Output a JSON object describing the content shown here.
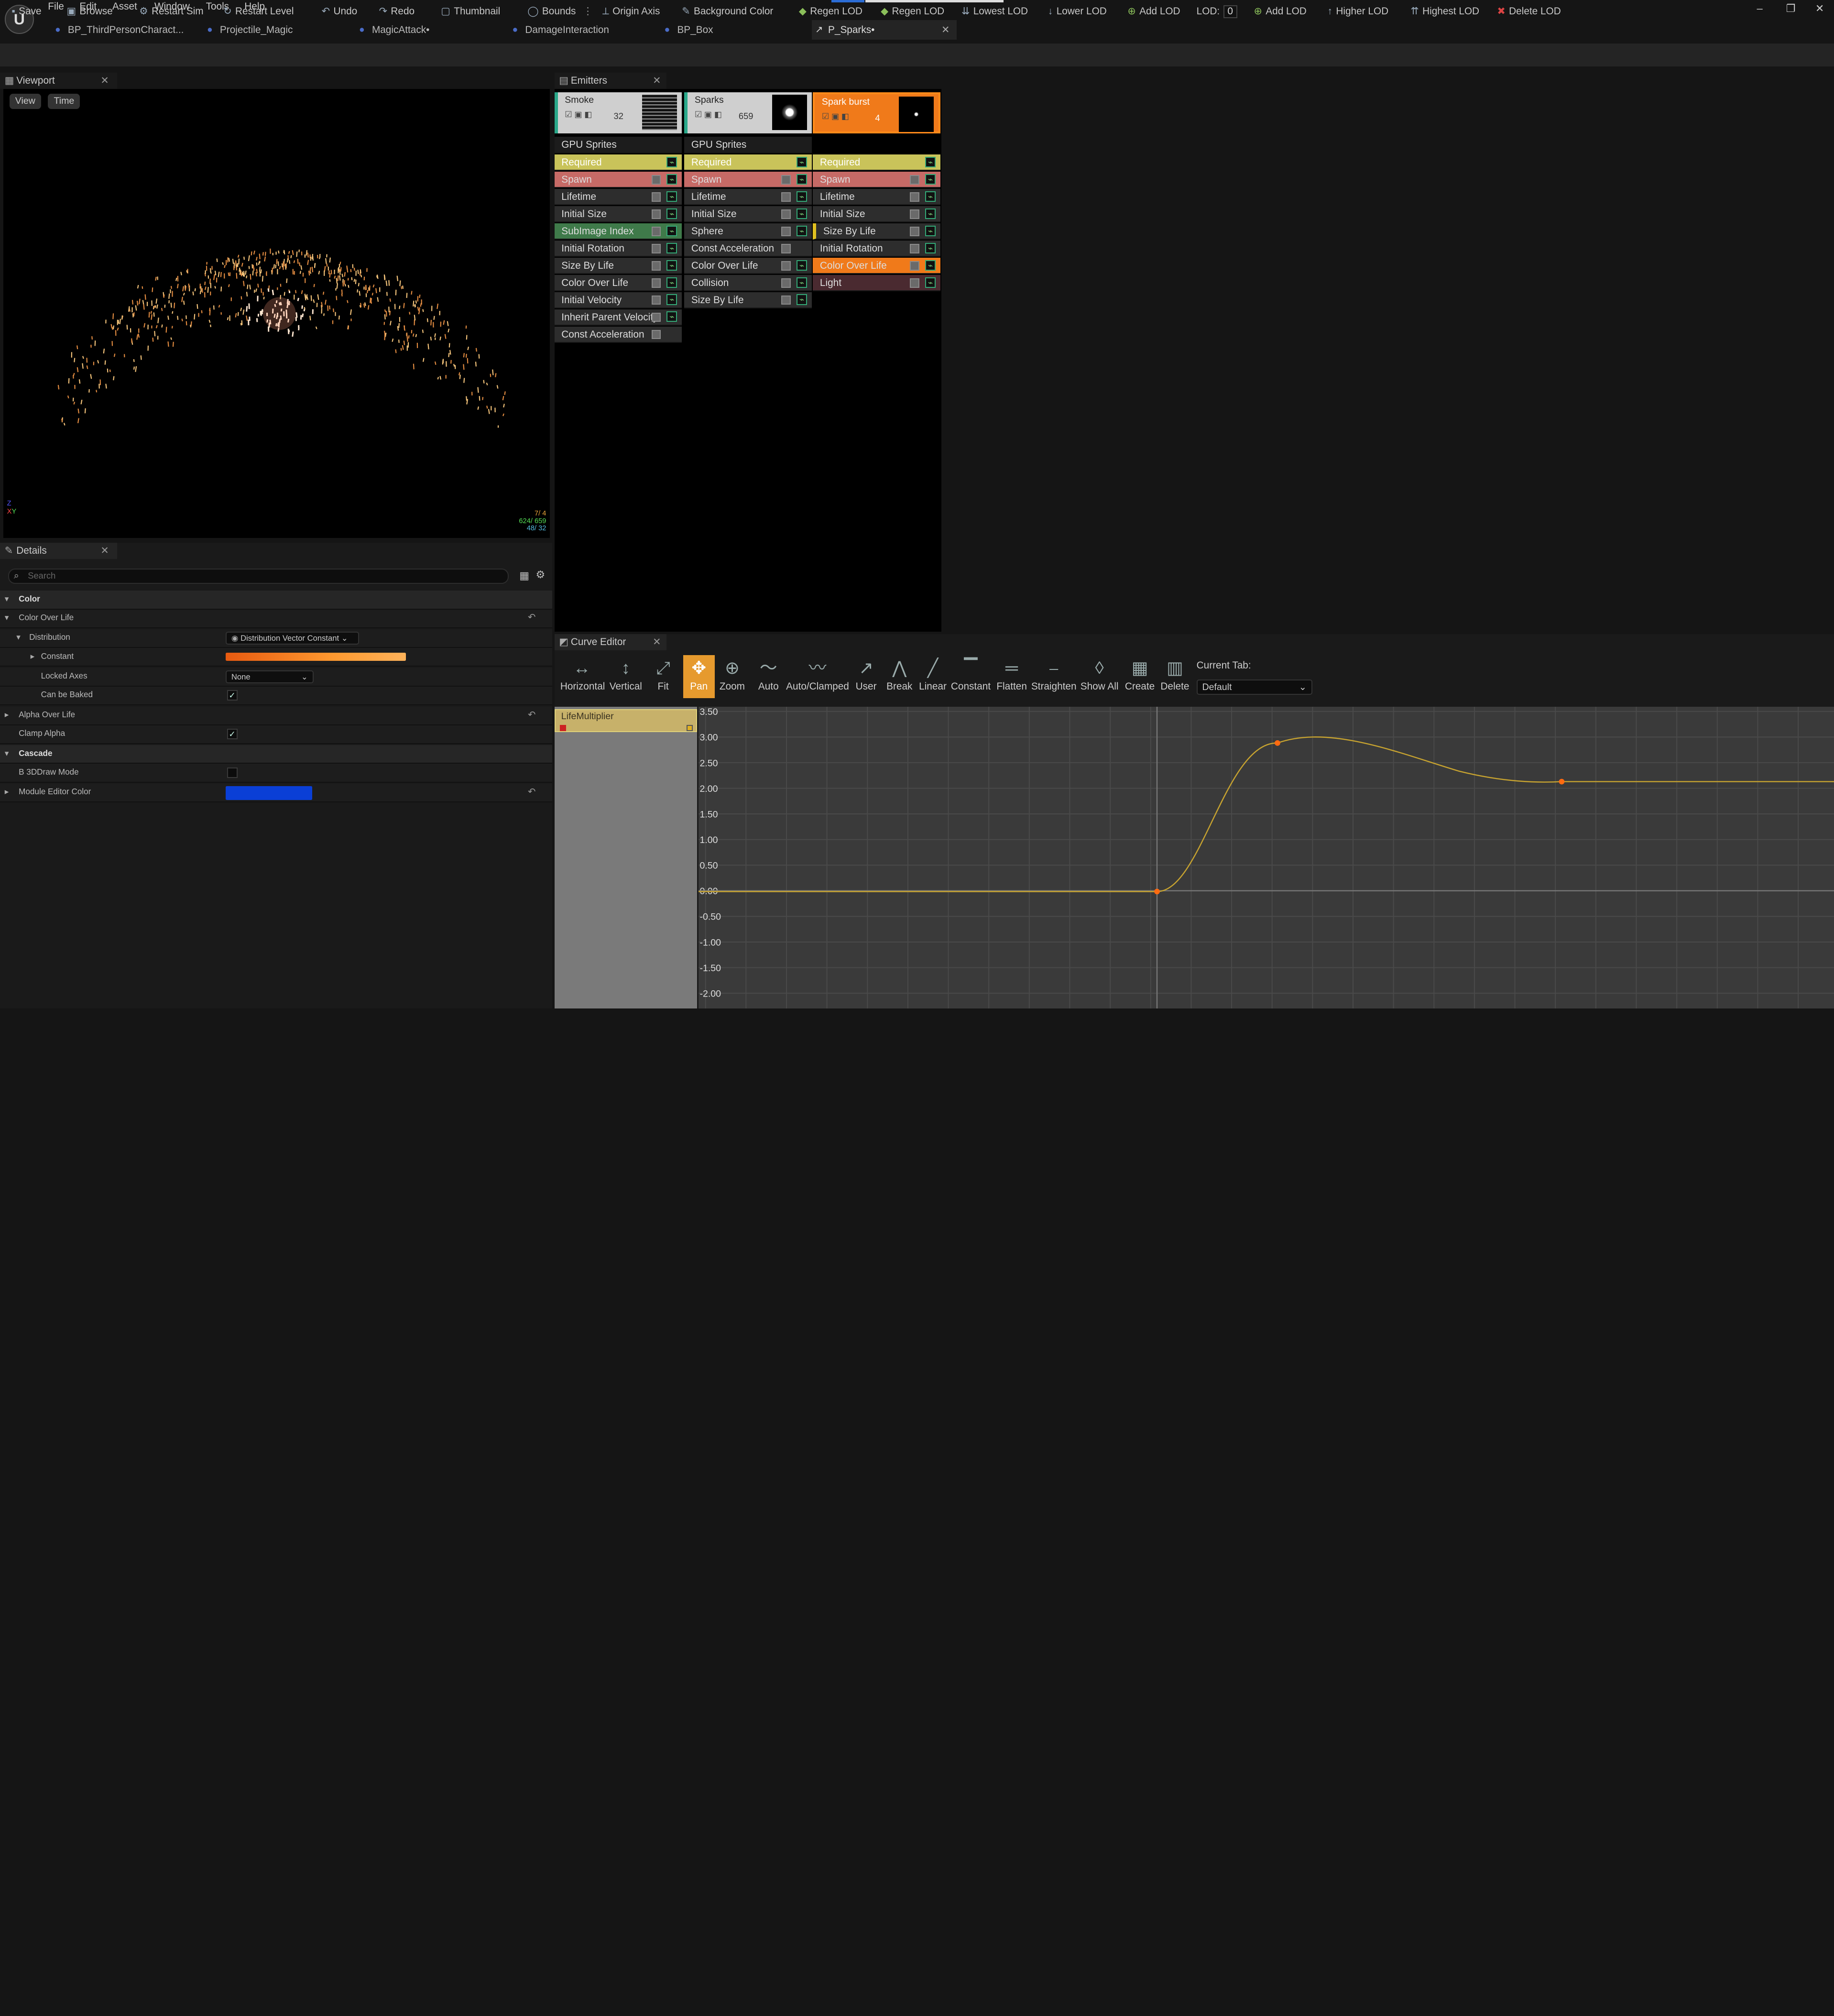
{
  "app": {
    "logo": "U"
  },
  "menu": [
    "File",
    "Edit",
    "Asset",
    "Window",
    "Tools",
    "Help"
  ],
  "window_controls": [
    "minimize-icon",
    "restore-icon",
    "close-icon"
  ],
  "doc_tabs": [
    {
      "label": "BP_ThirdPersonCharact...",
      "icon": "blueprint-icon"
    },
    {
      "label": "Projectile_Magic",
      "icon": "blueprint-icon"
    },
    {
      "label": "MagicAttack•",
      "icon": "montage-icon"
    },
    {
      "label": "DamageInteraction",
      "icon": "blueprint-icon"
    },
    {
      "label": "BP_Box",
      "icon": "blueprint-icon"
    },
    {
      "label": "P_Sparks•",
      "icon": "cascade-icon",
      "active": true
    }
  ],
  "toolbar": {
    "items": [
      "Save",
      "Browse",
      "Restart Sim",
      "Restart Level",
      "Undo",
      "Redo",
      "Thumbnail",
      "Bounds",
      "Origin Axis",
      "Background Color",
      "Regen LOD",
      "Regen LOD",
      "Lowest LOD",
      "Lower LOD",
      "Add LOD"
    ],
    "lod_label": "LOD:",
    "lod_value": "0",
    "items2": [
      "Add LOD",
      "Higher LOD",
      "Highest LOD",
      "Delete LOD"
    ]
  },
  "viewport": {
    "title": "Viewport",
    "buttons": [
      "View",
      "Time"
    ],
    "stats": [
      "7/ 4",
      "624/ 659",
      "48/ 32"
    ]
  },
  "details": {
    "title": "Details",
    "search_placeholder": "Search",
    "rows": [
      {
        "label": "Color",
        "kind": "cat"
      },
      {
        "label": "Color Over Life",
        "kind": "group"
      },
      {
        "label": "Distribution",
        "kind": "sub",
        "value": "Distribution Vector Constant"
      },
      {
        "label": "Constant",
        "kind": "sub2",
        "value": "gradient"
      },
      {
        "label": "Locked Axes",
        "kind": "sub2",
        "value": "None"
      },
      {
        "label": "Can be Baked",
        "kind": "sub2",
        "value": "checked"
      },
      {
        "label": "Alpha Over Life",
        "kind": "group"
      },
      {
        "label": "Clamp Alpha",
        "kind": "item",
        "value": "checked"
      },
      {
        "label": "Cascade",
        "kind": "cat"
      },
      {
        "label": "B 3DDraw Mode",
        "kind": "item",
        "value": "unchecked"
      },
      {
        "label": "Module Editor Color",
        "kind": "group",
        "value": "swatch"
      }
    ],
    "module_editor_color": "#0a3fd6"
  },
  "emitters": {
    "title": "Emitters",
    "columns": [
      {
        "name": "Smoke",
        "count": "32",
        "type": "GPU Sprites",
        "header_color": "#cfcfcf",
        "accent": "#2aa88a",
        "modules": [
          "Required",
          "Spawn",
          "Lifetime",
          "Initial Size",
          "SubImage Index",
          "Initial Rotation",
          "Size By Life",
          "Color Over Life",
          "Initial Velocity",
          "Inherit Parent Velocity",
          "Const Acceleration"
        ]
      },
      {
        "name": "Sparks",
        "count": "659",
        "type": "GPU Sprites",
        "header_color": "#cfcfcf",
        "accent": "#2aa88a",
        "modules": [
          "Required",
          "Spawn",
          "Lifetime",
          "Initial Size",
          "Sphere",
          "Const Acceleration",
          "Color Over Life",
          "Collision",
          "Size By Life"
        ]
      },
      {
        "name": "Spark burst",
        "count": "4",
        "type": "",
        "header_color": "#f07a1a",
        "accent": "#f07a1a",
        "modules": [
          "Required",
          "Spawn",
          "Lifetime",
          "Initial Size",
          "Size By Life",
          "Initial Rotation",
          "Color Over Life",
          "Light"
        ]
      }
    ]
  },
  "curve_editor": {
    "title": "Curve Editor",
    "buttons": [
      "Horizontal",
      "Vertical",
      "Fit",
      "Pan",
      "Zoom",
      "Auto",
      "Auto/Clamped",
      "User",
      "Break",
      "Linear",
      "Constant",
      "Flatten",
      "Straighten",
      "Show All",
      "Create",
      "Delete"
    ],
    "current_tab_label": "Current Tab:",
    "current_tab_value": "Default",
    "curve_name": "LifeMultiplier",
    "y_ticks": [
      "3.50",
      "3.00",
      "2.50",
      "2.00",
      "1.50",
      "1.00",
      "0.50",
      "0.00",
      "-0.50",
      "-1.00",
      "-1.50",
      "-2.00"
    ]
  }
}
